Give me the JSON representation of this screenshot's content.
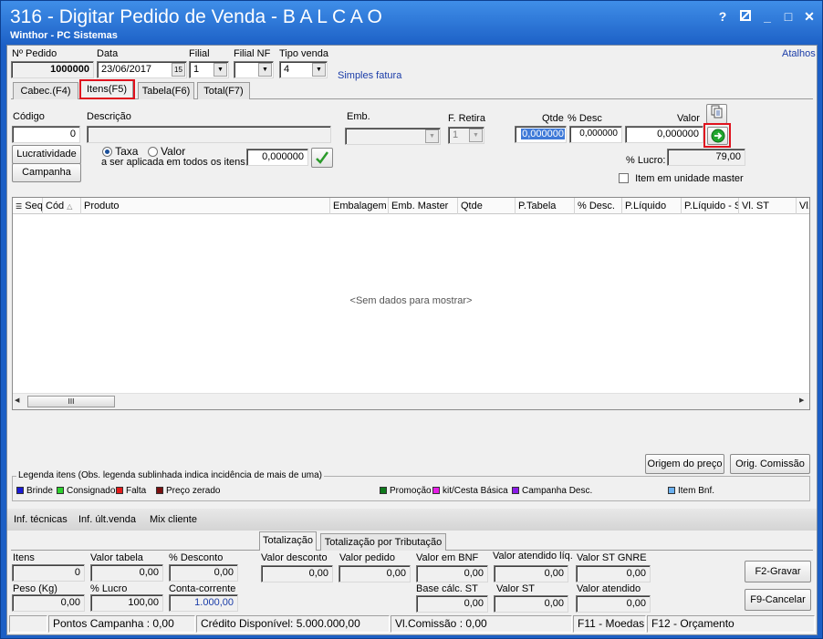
{
  "window": {
    "title": "316 - Digitar Pedido de Venda - B A L C A O",
    "subtitle": "Winthor - PC Sistemas",
    "help": "?",
    "minimize": "_",
    "maximize": "□",
    "close": "✕"
  },
  "header": {
    "pedido_label": "Nº Pedido",
    "pedido_value": "1000000",
    "data_label": "Data",
    "data_value": "23/06/2017",
    "calendar_glyph": "15",
    "filial_label": "Filial",
    "filial_value": "1",
    "filial_nf_label": "Filial NF",
    "filial_nf_value": "",
    "tipo_venda_label": "Tipo venda",
    "tipo_venda_value": "4",
    "tipo_venda_desc": "Simples fatura",
    "atalhos": "Atalhos"
  },
  "tabs": [
    {
      "label": "Cabec.(F4)"
    },
    {
      "label": "Itens(F5)"
    },
    {
      "label": "Tabela(F6)"
    },
    {
      "label": "Total(F7)"
    }
  ],
  "item": {
    "codigo_label": "Código",
    "codigo_value": "0",
    "descricao_label": "Descrição",
    "descricao_value": "",
    "emb_label": "Emb.",
    "emb_value": "",
    "fretira_label": "F. Retira",
    "fretira_value": "1",
    "qtde_label": "Qtde",
    "qtde_value": "0,000000",
    "desc_label": "% Desc",
    "desc_value": "0,000000",
    "valor_label": "Valor",
    "valor_value": "0,000000",
    "lucro_label": "% Lucro:",
    "lucro_value": "79,00",
    "item_master_label": "Item em unidade master",
    "lucratividade_btn": "Lucratividade",
    "campanha_btn": "Campanha",
    "taxa_label": "Taxa",
    "valor_radio_label": "Valor",
    "aplicada_label": "a ser aplicada em todos os itens:",
    "aplicada_value": "0,000000"
  },
  "grid": {
    "columns": [
      "Seq",
      "Cód",
      "Produto",
      "Embalagem",
      "Emb. Master",
      "Qtde",
      "P.Tabela",
      "% Desc.",
      "P.Líquido",
      "P.Líquido - S",
      "Vl. ST",
      "Vl."
    ],
    "empty_text": "<Sem dados para mostrar>",
    "scroll_left": "◀",
    "scroll_right": "▶",
    "scroll_grip": "III"
  },
  "buttons": {
    "origem_preco": "Origem do preço",
    "orig_comissao": "Orig. Comissão",
    "gravar": "F2-Gravar",
    "cancelar": "F9-Cancelar"
  },
  "legend": {
    "title": "Legenda itens (Obs. legenda sublinhada indica incidência de mais de uma)",
    "items": [
      {
        "label": "Brinde",
        "color": "#1a1ad6"
      },
      {
        "label": "Consignado",
        "color": "#2ed12e"
      },
      {
        "label": "Falta",
        "color": "#e21b1b"
      },
      {
        "label": "Preço zerado",
        "color": "#7a1010"
      },
      {
        "label": "Promoção",
        "color": "#0f7a1c"
      },
      {
        "label": "kit/Cesta Básica",
        "color": "#e61ee6"
      },
      {
        "label": "Campanha Desc.",
        "color": "#8a1be6"
      },
      {
        "label": "Item Bnf.",
        "color": "#6ab0f0"
      }
    ]
  },
  "infolinks": [
    "Inf. técnicas",
    "Inf. últ.venda",
    "Mix cliente"
  ],
  "bottom_tabs": [
    "Totalização",
    "Totalização por Tributação"
  ],
  "totals": {
    "itens_label": "Itens",
    "itens_value": "0",
    "valor_tabela_label": "Valor tabela",
    "valor_tabela_value": "0,00",
    "pct_desconto_label": "% Desconto",
    "pct_desconto_value": "0,00",
    "valor_desconto_label": "Valor desconto",
    "valor_desconto_value": "0,00",
    "valor_pedido_label": "Valor pedido",
    "valor_pedido_value": "0,00",
    "valor_bnf_label": "Valor em BNF",
    "valor_bnf_value": "0,00",
    "valor_atendido_liq_label": "Valor atendido líq.",
    "valor_atendido_liq_value": "0,00",
    "valor_st_gnre_label": "Valor ST GNRE",
    "valor_st_gnre_value": "0,00",
    "peso_label": "Peso (Kg)",
    "peso_value": "0,00",
    "pct_lucro_label": "% Lucro",
    "pct_lucro_value": "100,00",
    "conta_corrente_label": "Conta-corrente",
    "conta_corrente_value": "1.000,00",
    "base_st_label": "Base cálc. ST",
    "base_st_value": "0,00",
    "valor_st_label": "Valor ST",
    "valor_st_value": "0,00",
    "valor_atendido_label": "Valor atendido",
    "valor_atendido_value": "0,00"
  },
  "status": {
    "pontos": "Pontos Campanha : 0,00",
    "credito": "Crédito Disponível: 5.000.000,00",
    "comissao": "Vl.Comissão : 0,00",
    "moedas": "F11 - Moedas",
    "orcamento": "F12 - Orçamento"
  }
}
